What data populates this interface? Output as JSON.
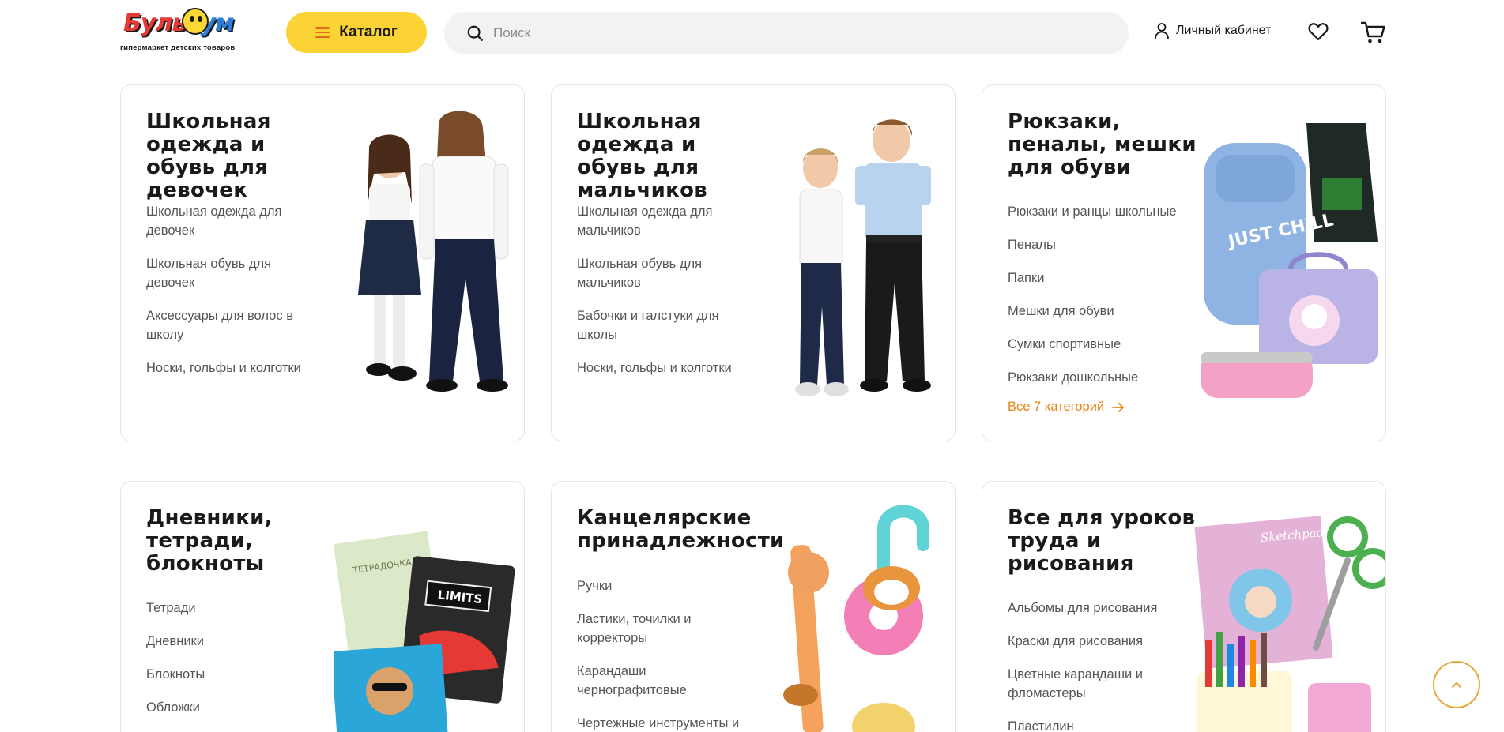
{
  "header": {
    "logo_text_1": "Буль",
    "logo_text_2": "Гум",
    "logo_subtitle": "гипермаркет детских товаров",
    "catalog_label": "Каталог",
    "search_placeholder": "Поиск",
    "account_label": "Личный кабинет"
  },
  "colors": {
    "accent_yellow": "#fbd334",
    "accent_orange": "#e8830f",
    "text_dark": "#1a1a1a",
    "text_muted": "#555555"
  },
  "cards": [
    {
      "title": "Школьная одежда и обувь для девочек",
      "links": [
        "Школьная одежда для девочек",
        "Школьная обувь для девочек",
        "Аксессуары для волос в школу",
        "Носки, гольфы и колготки"
      ]
    },
    {
      "title": "Школьная одежда и обувь для мальчиков",
      "links": [
        "Школьная одежда для мальчиков",
        "Школьная обувь для мальчиков",
        "Бабочки и галстуки для школы",
        "Носки, гольфы и колготки"
      ]
    },
    {
      "title": "Рюкзаки, пеналы, мешки для обуви",
      "links": [
        "Рюкзаки и ранцы школьные",
        "Пеналы",
        "Папки",
        "Мешки для обуви",
        "Сумки спортивные",
        "Рюкзаки дошкольные"
      ],
      "more": "Все 7 категорий"
    },
    {
      "title": "Дневники, тетради, блокноты",
      "links": [
        "Тетради",
        "Дневники",
        "Блокноты",
        "Обложки"
      ]
    },
    {
      "title": "Канцелярские принадлежности",
      "links": [
        "Ручки",
        "Ластики, точилки и корректоры",
        "Карандаши чернографитовые",
        "Чертежные инструменты и"
      ]
    },
    {
      "title": "Все для уроков труда и рисования",
      "links": [
        "Альбомы для рисования",
        "Краски для рисования",
        "Цветные карандаши и фломастеры",
        "Пластилин"
      ]
    }
  ],
  "images": {
    "notebook_1_text": "ТЕТРАДОЧКА",
    "notebook_2_text": "LIMITS",
    "sketchpad_text": "Sketchpad",
    "backpack_text": "JUST CHILL"
  },
  "icons": {
    "search": "search-icon",
    "account": "user-icon",
    "favorites": "heart-icon",
    "cart": "cart-icon",
    "more": "arrow-right-icon",
    "scroll_top": "chevron-up-icon"
  }
}
